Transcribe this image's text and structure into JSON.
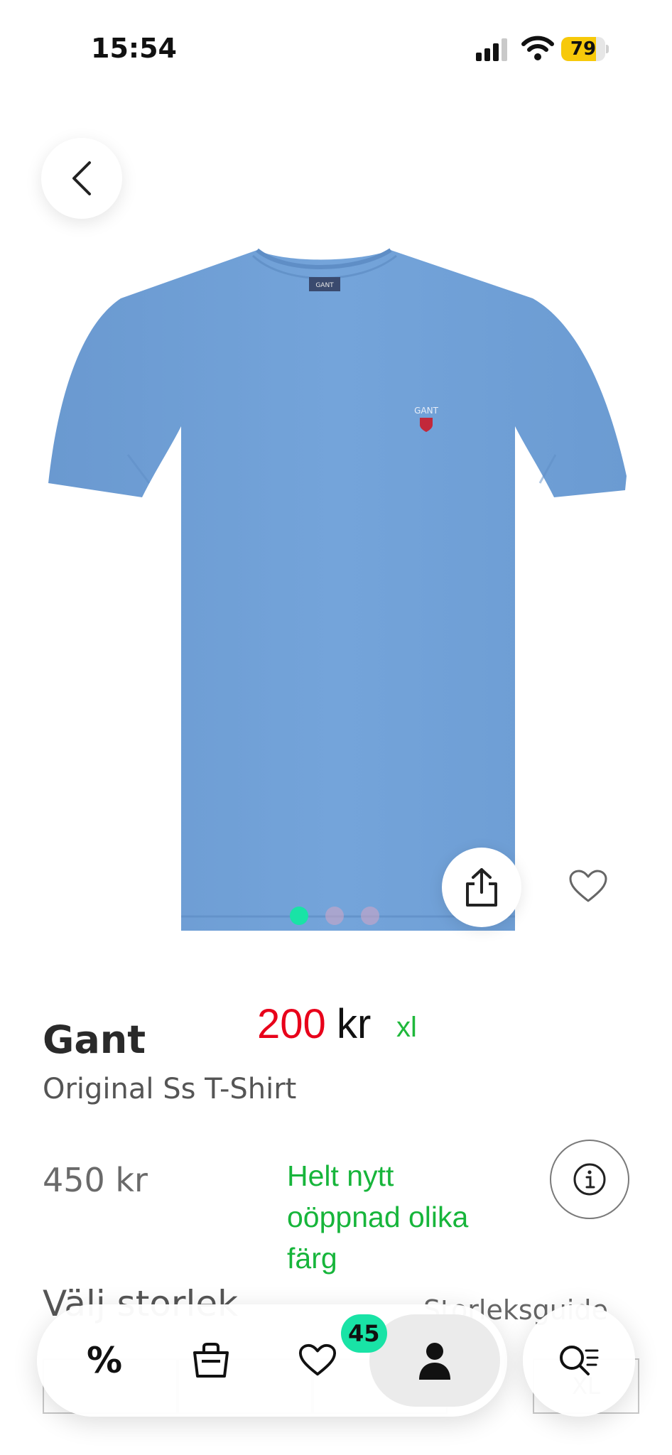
{
  "status_bar": {
    "time": "15:54",
    "battery": "79",
    "battery_level": 0.79,
    "battery_color": "#f7c90a"
  },
  "product": {
    "brand": "Gant",
    "name": "Original Ss T-Shirt",
    "price": "450 kr",
    "image_colors": {
      "shirt": "#6f9fd6",
      "logo": "#c2283a"
    },
    "image_count": 3,
    "active_image": 1,
    "logo_text": "GANT"
  },
  "overlay": {
    "price_value": "200",
    "price_unit": "kr",
    "size": "xl",
    "note_lines": [
      "Helt nytt",
      "oöppnad olika",
      "färg"
    ]
  },
  "sizes": {
    "title": "Välj storlek",
    "guide_link": "Storleksguide",
    "options": [
      "",
      "",
      "",
      "XL"
    ]
  },
  "bottom_nav": {
    "items": [
      "discount-icon",
      "bag-icon",
      "heart-icon",
      "profile-icon"
    ],
    "favorites_badge": "45",
    "active_item": "profile-icon",
    "accent": "#19e3a6"
  }
}
